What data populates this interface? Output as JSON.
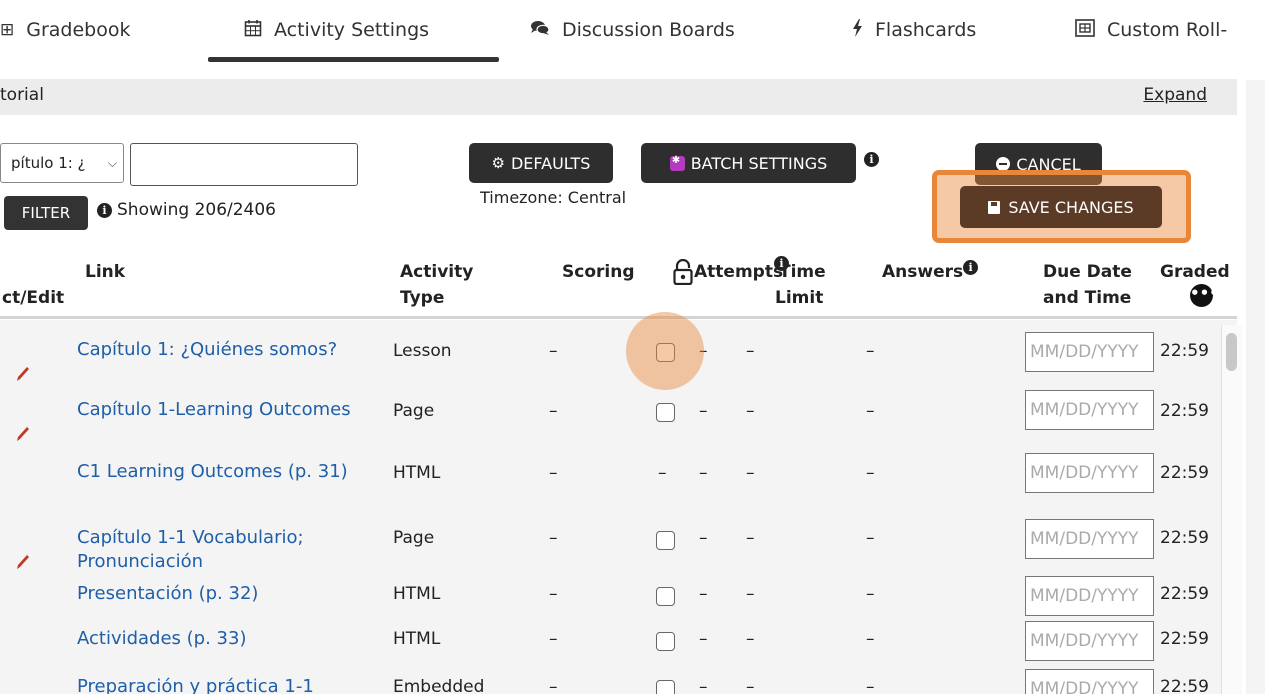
{
  "tabs": [
    {
      "label": "Gradebook",
      "icon": "table-icon"
    },
    {
      "label": "Activity Settings",
      "icon": "calendar-icon"
    },
    {
      "label": "Discussion Boards",
      "icon": "comments-icon"
    },
    {
      "label": "Flashcards",
      "icon": "bolt-icon"
    },
    {
      "label": "Custom Roll-",
      "icon": "custom-rollup-icon"
    }
  ],
  "tutorial": {
    "label": "torial",
    "expand": "Expand"
  },
  "controls": {
    "chapter_select": "pítulo 1: ¿",
    "search_value": "",
    "filter": "FILTER",
    "showing": "Showing 206/2406",
    "defaults": "DEFAULTS",
    "batch": "BATCH SETTINGS",
    "timezone": "Timezone: Central",
    "cancel": "CANCEL",
    "save": "SAVE CHANGES"
  },
  "headers": {
    "select_edit": "ct/Edit",
    "link": "Link",
    "activity": "Activity",
    "type": "Type",
    "scoring": "Scoring",
    "attempts": "Attempts",
    "time": "Time",
    "limit": "Limit",
    "answers": "Answers",
    "due_date": "Due Date",
    "and_time": "and Time",
    "graded": "Graded"
  },
  "rows": [
    {
      "title": "Capítulo 1: ¿Quiénes somos?",
      "type": "Lesson",
      "scoring": "–",
      "attempts": "–",
      "time": "–",
      "answers": "–",
      "date_placeholder": "MM/DD/YYYY",
      "due_time": "22:59"
    },
    {
      "title": "Capítulo 1-Learning Outcomes",
      "type": "Page",
      "scoring": "–",
      "attempts": "–",
      "time": "–",
      "answers": "–",
      "date_placeholder": "MM/DD/YYYY",
      "due_time": "22:59"
    },
    {
      "title": "C1 Learning Outcomes (p. 31)",
      "type": "HTML",
      "scoring": "–",
      "lock": "–",
      "attempts": "–",
      "time": "–",
      "answers": "–",
      "date_placeholder": "MM/DD/YYYY",
      "due_time": "22:59"
    },
    {
      "title": "Capítulo 1-1 Vocabulario; Pronunciación",
      "type": "Page",
      "scoring": "–",
      "attempts": "–",
      "time": "–",
      "answers": "–",
      "date_placeholder": "MM/DD/YYYY",
      "due_time": "22:59"
    },
    {
      "title": "Presentación (p. 32)",
      "type": "HTML",
      "scoring": "–",
      "attempts": "–",
      "time": "–",
      "answers": "–",
      "date_placeholder": "MM/DD/YYYY",
      "due_time": "22:59"
    },
    {
      "title": "Actividades (p. 33)",
      "type": "HTML",
      "scoring": "–",
      "attempts": "–",
      "time": "–",
      "answers": "–",
      "date_placeholder": "MM/DD/YYYY",
      "due_time": "22:59"
    },
    {
      "title": "Preparación y práctica 1-1",
      "type": "Embedded",
      "scoring": "–",
      "attempts": "–",
      "time": "–",
      "answers": "–",
      "date_placeholder": "MM/DD/YYYY",
      "due_time": "22:59"
    }
  ]
}
